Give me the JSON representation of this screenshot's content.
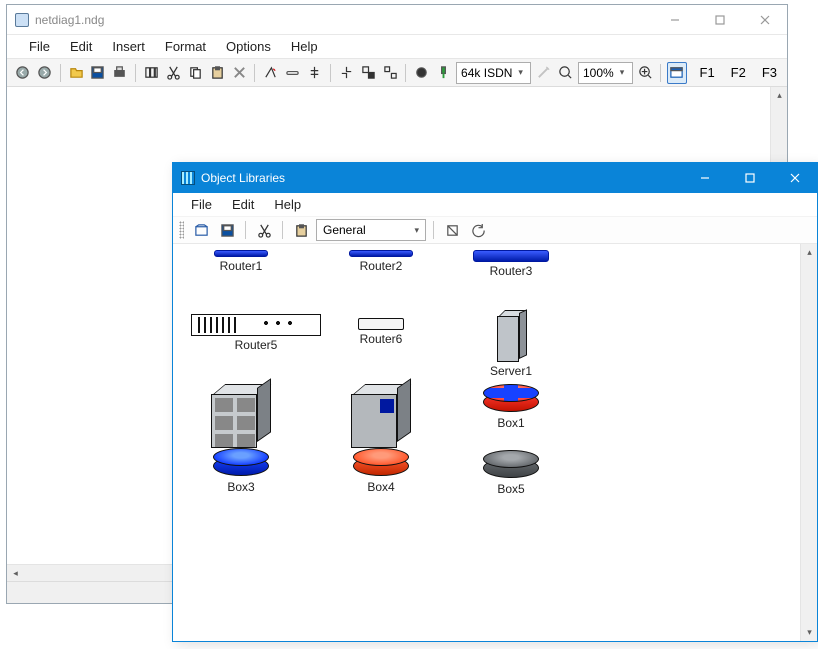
{
  "main": {
    "title": "netdiag1.ndg",
    "menus": [
      "File",
      "Edit",
      "Insert",
      "Format",
      "Options",
      "Help"
    ],
    "link_speed": "64k ISDN",
    "zoom": "100%",
    "fkeys": [
      "F1",
      "F2",
      "F3"
    ]
  },
  "library": {
    "title": "Object Libraries",
    "menus": [
      "File",
      "Edit",
      "Help"
    ],
    "category": "General",
    "items": [
      {
        "label": "Router1"
      },
      {
        "label": "Router2"
      },
      {
        "label": "Router3"
      },
      {
        "label": "Router5"
      },
      {
        "label": "Router6"
      },
      {
        "label": "Server1"
      },
      {
        "label": "Box1"
      },
      {
        "label": "Box3"
      },
      {
        "label": "Box4"
      },
      {
        "label": "Box5"
      }
    ]
  }
}
